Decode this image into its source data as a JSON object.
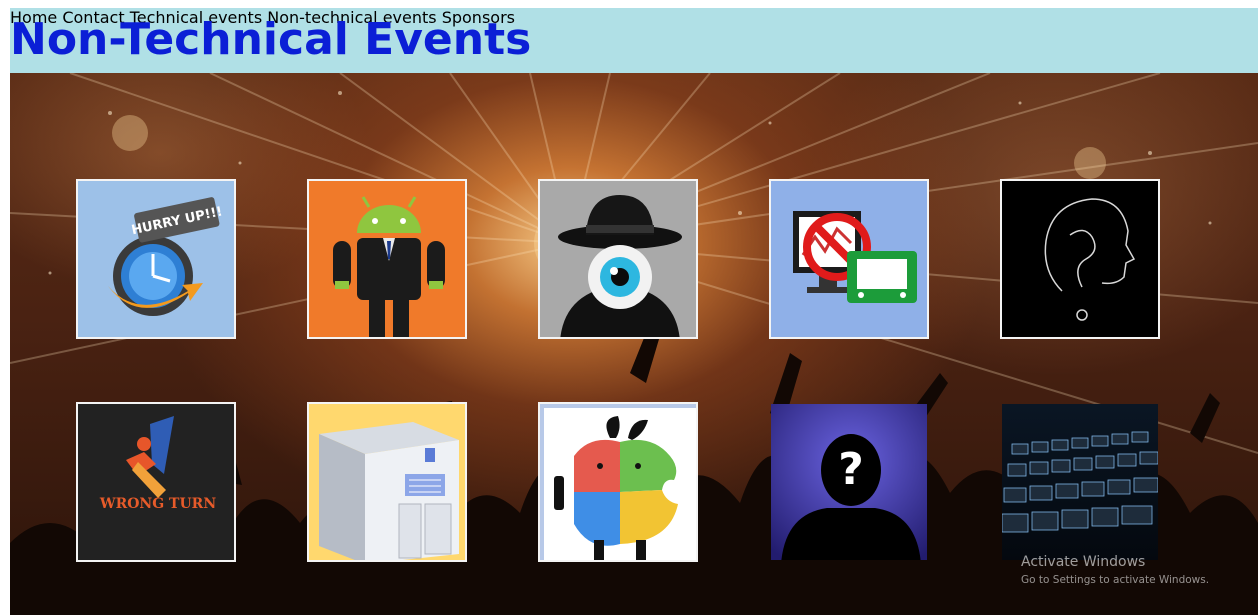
{
  "header": {
    "title": "Non-Technical Events",
    "nav": [
      "Home",
      "Contact",
      "Technical events",
      "Non-technical events",
      "Sponsors"
    ]
  },
  "events": [
    {
      "name": "hurry-up-icon",
      "badge": "HURRY UP!!!"
    },
    {
      "name": "android-suit-icon"
    },
    {
      "name": "spy-eye-icon"
    },
    {
      "name": "no-computer-icon"
    },
    {
      "name": "head-question-icon"
    },
    {
      "name": "wrong-turn-icon",
      "label": "WRONG TURN"
    },
    {
      "name": "computer-tower-icon"
    },
    {
      "name": "windows-apple-icon"
    },
    {
      "name": "mystery-person-icon",
      "symbol": "?"
    },
    {
      "name": "keyboard-icon"
    }
  ],
  "watermark": {
    "line1": "Activate Windows",
    "line2": "Go to Settings to activate Windows."
  },
  "colors": {
    "title": "#0b1fd6",
    "topbar": "#b0e0e6"
  }
}
